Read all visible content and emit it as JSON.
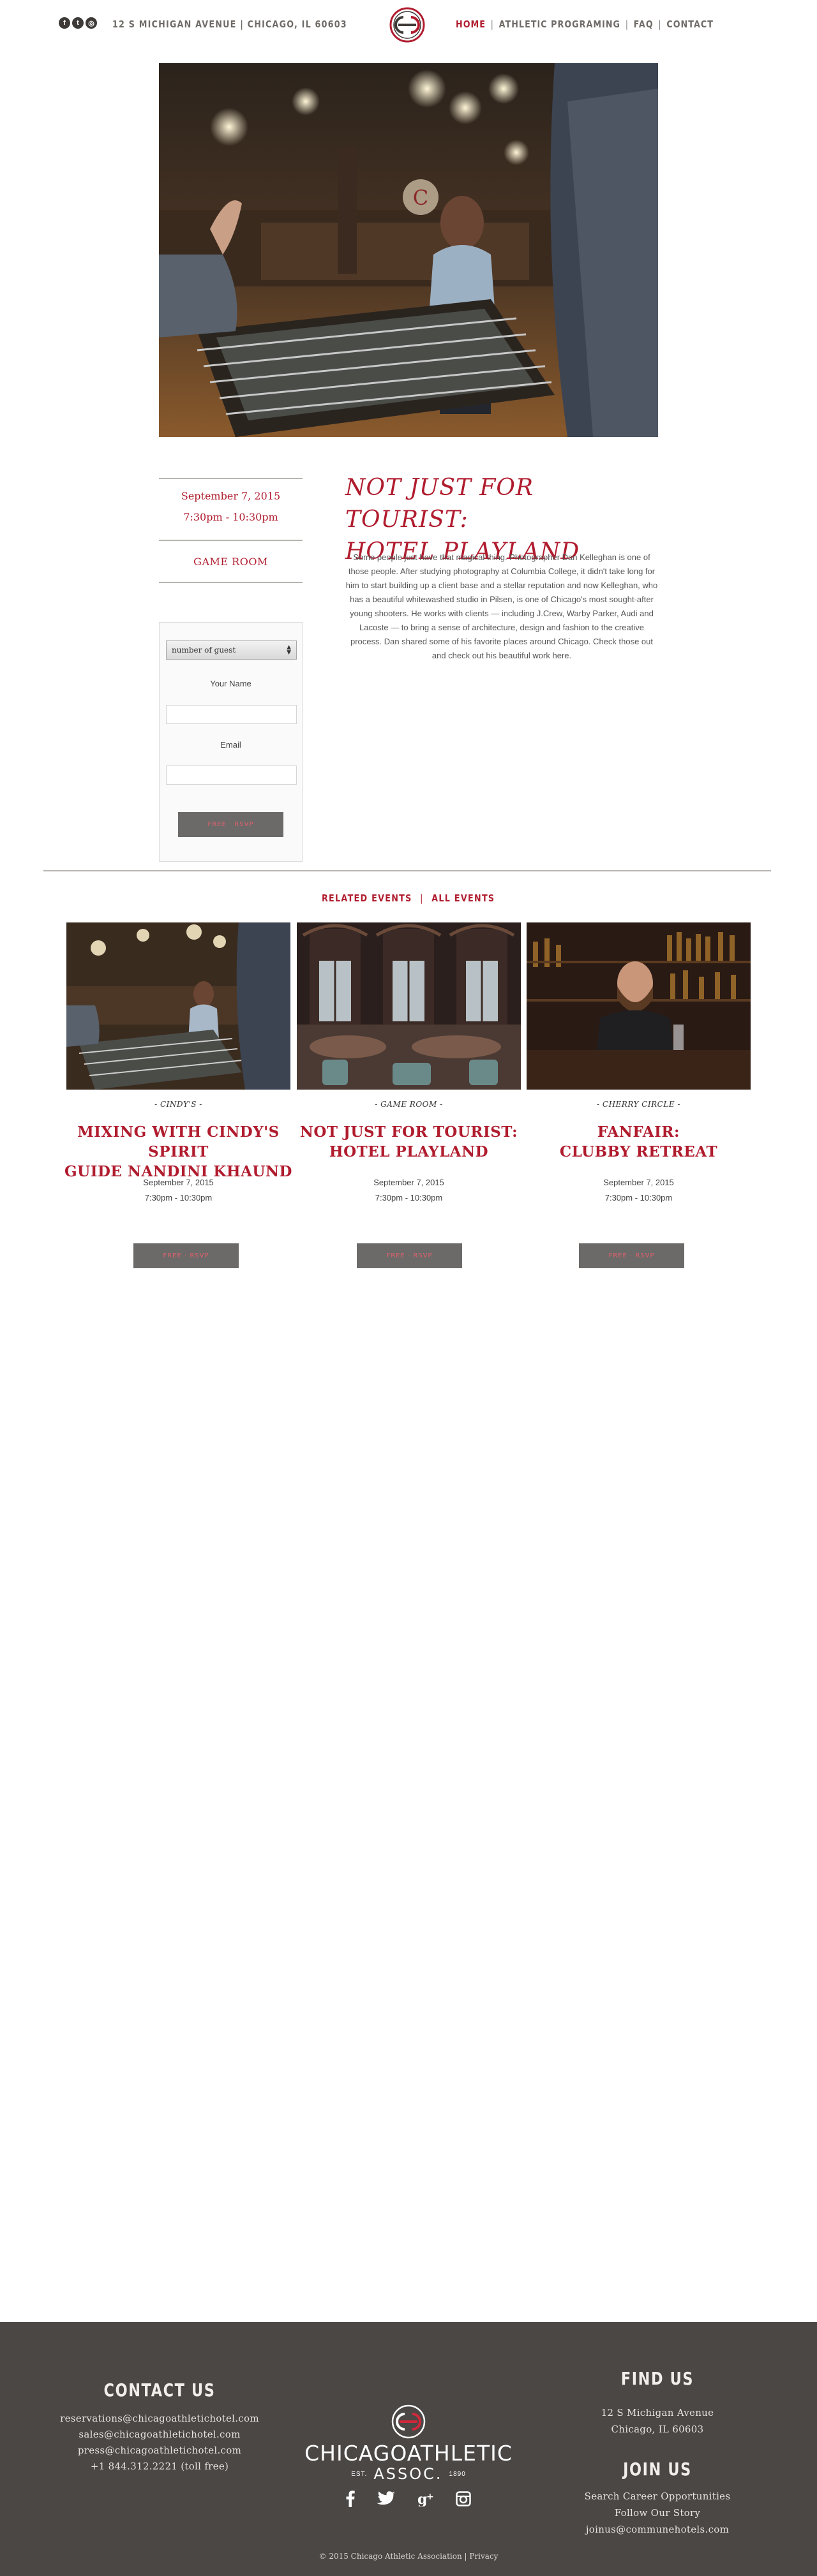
{
  "header": {
    "social": [
      {
        "icon": "facebook-icon",
        "glyph": "f"
      },
      {
        "icon": "twitter-icon",
        "glyph": "t"
      },
      {
        "icon": "instagram-icon",
        "glyph": "◎"
      }
    ],
    "address": "12 S Michigan Avenue  |  Chicago, IL 60603",
    "nav": [
      {
        "label": "Home"
      },
      {
        "label": "Athletic Programing"
      },
      {
        "label": "FAQ"
      },
      {
        "label": "Contact"
      }
    ]
  },
  "event": {
    "date": "September 7, 2015",
    "time": "7:30pm - 10:30pm",
    "venue": "GAME ROOM",
    "title_line1": "NOT JUST FOR TOURIST:",
    "title_line2": "HOTEL PLAYLAND",
    "body": "Some people just have that magical thing. Photographer Dan Kelleghan is one of those people. After studying photography at Columbia College, it didn't take long for him to start building up a client base and a stellar reputation and now Kelleghan, who has a beautiful whitewashed studio in Pilsen, is one of Chicago's most sought-after young shooters. He works with clients — including J.Crew, Warby Parker, Audi and Lacoste — to bring a sense of architecture, design and fashion to the creative process. Dan shared some of his favorite places around Chicago. Check those out and check out his beautiful work here."
  },
  "rsvp": {
    "guest_select": "number of guest",
    "name_label": "Your Name",
    "email_label": "Email",
    "button": "FREE · RSVP"
  },
  "related": {
    "heading_left": "RELATED EVENTS",
    "heading_right": "ALL EVENTS",
    "cards": [
      {
        "venue": "- CINDY'S -",
        "title_line1": "MIXING WITH CINDY'S SPIRIT",
        "title_line2": "GUIDE NANDINI KHAUND",
        "date": "September 7, 2015",
        "time": "7:30pm - 10:30pm",
        "button": "FREE · RSVP"
      },
      {
        "venue": "- GAME ROOM -",
        "title_line1": "NOT JUST FOR TOURIST:",
        "title_line2": "HOTEL PLAYLAND",
        "date": "September 7, 2015",
        "time": "7:30pm - 10:30pm",
        "button": "FREE · RSVP"
      },
      {
        "venue": "- CHERRY CIRCLE -",
        "title_line1": "FANFAIR:",
        "title_line2": "CLUBBY RETREAT",
        "date": "September 7, 2015",
        "time": "7:30pm - 10:30pm",
        "button": "FREE · RSVP"
      }
    ]
  },
  "footer": {
    "contact_heading": "CONTACT US",
    "contact_lines": [
      "reservations@chicagoathletichotel.com",
      "sales@chicagoathletichotel.com",
      "press@chicagoathletichotel.com",
      "+1 844.312.2221 (toll free)"
    ],
    "brand_name": "CHICAGOATHLETIC",
    "brand_sub": "ASSOC.",
    "brand_est": "EST.",
    "brand_year": "1890",
    "find_heading": "FIND US",
    "find_lines": [
      "12 S Michigan Avenue",
      "Chicago, IL 60603"
    ],
    "join_heading": "JOIN US",
    "join_lines": [
      "Search Career Opportunities",
      "Follow Our Story",
      "joinus@communehotels.com"
    ],
    "social": [
      "facebook-icon",
      "twitter-icon",
      "google-plus-icon",
      "instagram-icon"
    ],
    "copyright": "© 2015 Chicago Athletic Association | Privacy"
  }
}
